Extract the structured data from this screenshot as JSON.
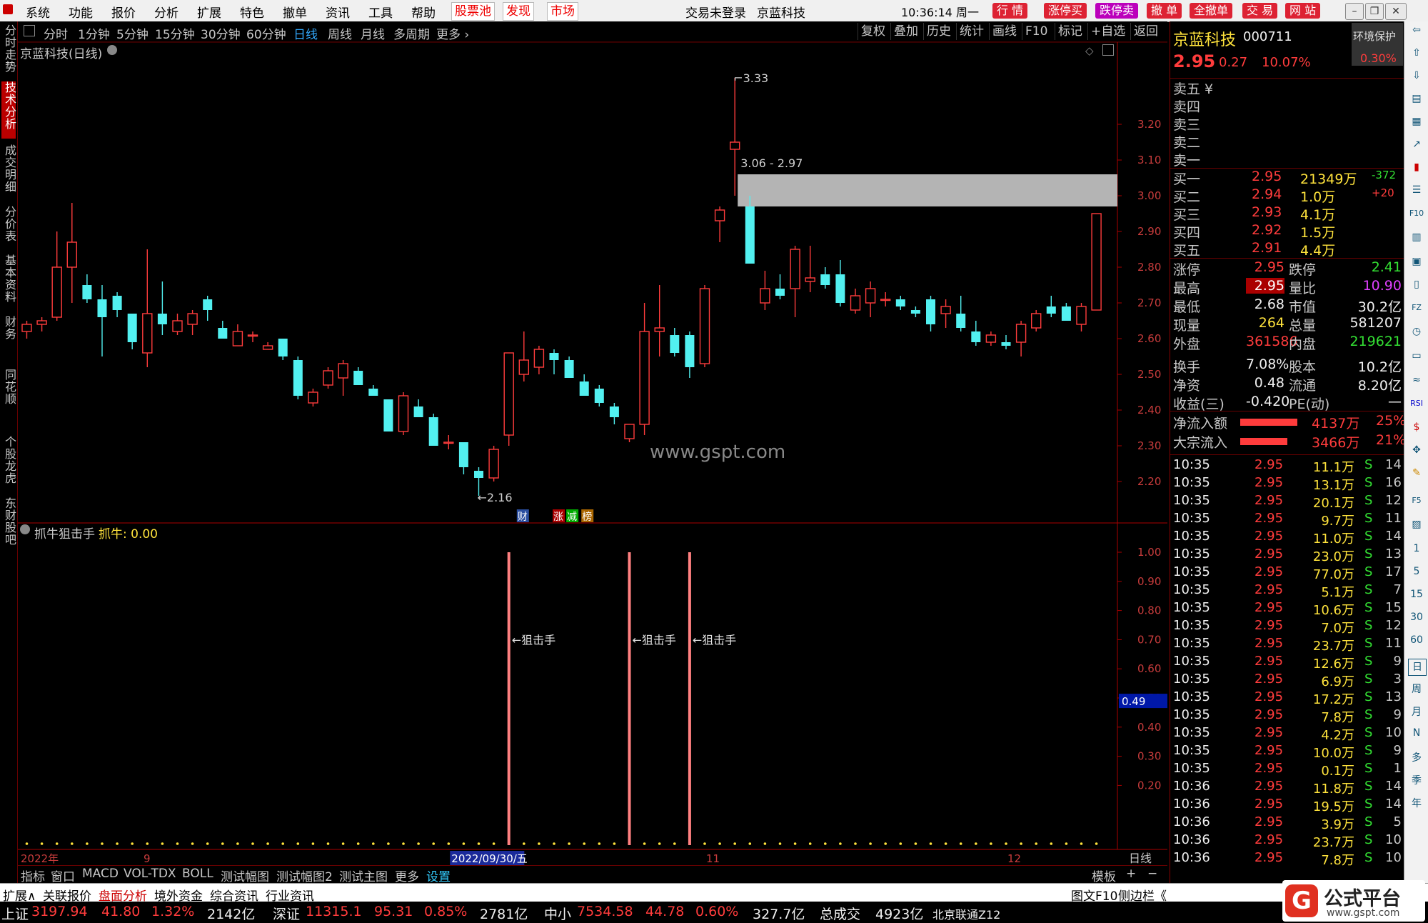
{
  "menu": {
    "items": [
      "系统",
      "功能",
      "报价",
      "分析",
      "扩展",
      "特色",
      "撤单",
      "资讯",
      "工具",
      "帮助"
    ],
    "red_tabs": [
      "股票池",
      "发现",
      "市场"
    ],
    "login_status": "交易未登录",
    "stock_name": "京蓝科技",
    "clock": "10:36:14 周一",
    "buttons": [
      "行 情",
      "涨停买",
      "跌停卖",
      "撤 单",
      "全撤单",
      "交 易",
      "网 站"
    ]
  },
  "left_tabs": [
    {
      "label": "分时走势",
      "active": false
    },
    {
      "label": "技术分析",
      "active": true
    },
    {
      "label": "成交明细",
      "active": false
    },
    {
      "label": "分价表",
      "active": false
    },
    {
      "label": "基本资料",
      "active": false
    },
    {
      "label": "财务",
      "active": false
    },
    {
      "label": "同花顺",
      "active": false
    },
    {
      "label": "个股龙虎",
      "active": false
    },
    {
      "label": "东财股吧",
      "active": false
    }
  ],
  "chart_toolbar": {
    "periods": [
      "分时",
      "1分钟",
      "5分钟",
      "15分钟",
      "30分钟",
      "60分钟",
      "日线",
      "周线",
      "月线",
      "多周期",
      "更多 ›"
    ],
    "selected": "日线",
    "right_tools": [
      "复权",
      "叠加",
      "历史",
      "统计",
      "画线",
      "F10",
      "标记",
      "+自选",
      "返回"
    ]
  },
  "main_chart": {
    "title": "京蓝科技(日线)",
    "high_label": "3.33",
    "low_label": "2.16",
    "gap_label": "3.06 - 2.97",
    "watermark": "www.gspt.com",
    "markers": [
      "财",
      "涨",
      "减",
      "榜"
    ]
  },
  "indicator": {
    "title": "抓牛狙击手",
    "value_label": "抓牛: 0.00",
    "signal_label": "←狙击手",
    "current_value": "0.49"
  },
  "x_axis": {
    "labels": [
      "2022年",
      "9",
      "2022/09/30/五",
      "11",
      "12"
    ],
    "right": "日线"
  },
  "bottom_tabs": [
    "指标",
    "窗口",
    "MACD",
    "VOL-TDX",
    "BOLL",
    "测试幅图",
    "测试幅图2",
    "测试主图",
    "更多",
    "设置"
  ],
  "bottom_right": [
    "模板",
    "+",
    "−"
  ],
  "quote": {
    "name": "京蓝科技",
    "code": "000711",
    "env_label": "环境保护",
    "env_pct": "0.30%",
    "price": "2.95",
    "change": "0.27",
    "change_pct": "10.07%",
    "sells": [
      "卖五 ¥",
      "卖四",
      "卖三",
      "卖二",
      "卖一"
    ],
    "buys": [
      {
        "label": "买一",
        "price": "2.95",
        "vol": "21349万",
        "delta": "-372"
      },
      {
        "label": "买二",
        "price": "2.94",
        "vol": "1.0万",
        "delta": "+20"
      },
      {
        "label": "买三",
        "price": "2.93",
        "vol": "4.1万",
        "delta": ""
      },
      {
        "label": "买四",
        "price": "2.92",
        "vol": "1.5万",
        "delta": ""
      },
      {
        "label": "买五",
        "price": "2.91",
        "vol": "4.4万",
        "delta": ""
      }
    ],
    "stats": [
      {
        "l1": "涨停",
        "v1": "2.95",
        "l2": "跌停",
        "v2": "2.41"
      },
      {
        "l1": "最高",
        "v1": "2.95",
        "l2": "量比",
        "v2": "10.90"
      },
      {
        "l1": "最低",
        "v1": "2.68",
        "l2": "市值",
        "v2": "30.2亿"
      },
      {
        "l1": "现量",
        "v1": "264",
        "l2": "总量",
        "v2": "581207"
      },
      {
        "l1": "外盘",
        "v1": "361586",
        "l2": "内盘",
        "v2": "219621"
      },
      {
        "l1": "换手",
        "v1": "7.08%",
        "l2": "股本",
        "v2": "10.2亿"
      },
      {
        "l1": "净资",
        "v1": "0.48",
        "l2": "流通",
        "v2": "8.20亿"
      },
      {
        "l1": "收益(三)",
        "v1": "-0.420",
        "l2": "PE(动)",
        "v2": "—"
      }
    ],
    "flows": [
      {
        "label": "净流入额",
        "amount": "4137万",
        "pct": "25%"
      },
      {
        "label": "大宗流入",
        "amount": "3466万",
        "pct": "21%"
      }
    ],
    "ticks": [
      {
        "t": "10:35",
        "p": "2.95",
        "v": "11.1万",
        "s": "S",
        "n": "14"
      },
      {
        "t": "10:35",
        "p": "2.95",
        "v": "13.1万",
        "s": "S",
        "n": "16"
      },
      {
        "t": "10:35",
        "p": "2.95",
        "v": "20.1万",
        "s": "S",
        "n": "12"
      },
      {
        "t": "10:35",
        "p": "2.95",
        "v": "9.7万",
        "s": "S",
        "n": "11"
      },
      {
        "t": "10:35",
        "p": "2.95",
        "v": "11.0万",
        "s": "S",
        "n": "14"
      },
      {
        "t": "10:35",
        "p": "2.95",
        "v": "23.0万",
        "s": "S",
        "n": "13"
      },
      {
        "t": "10:35",
        "p": "2.95",
        "v": "77.0万",
        "s": "S",
        "n": "17"
      },
      {
        "t": "10:35",
        "p": "2.95",
        "v": "5.1万",
        "s": "S",
        "n": "7"
      },
      {
        "t": "10:35",
        "p": "2.95",
        "v": "10.6万",
        "s": "S",
        "n": "15"
      },
      {
        "t": "10:35",
        "p": "2.95",
        "v": "7.0万",
        "s": "S",
        "n": "12"
      },
      {
        "t": "10:35",
        "p": "2.95",
        "v": "23.7万",
        "s": "S",
        "n": "11"
      },
      {
        "t": "10:35",
        "p": "2.95",
        "v": "12.6万",
        "s": "S",
        "n": "9"
      },
      {
        "t": "10:35",
        "p": "2.95",
        "v": "6.9万",
        "s": "S",
        "n": "3"
      },
      {
        "t": "10:35",
        "p": "2.95",
        "v": "17.2万",
        "s": "S",
        "n": "13"
      },
      {
        "t": "10:35",
        "p": "2.95",
        "v": "7.8万",
        "s": "S",
        "n": "9"
      },
      {
        "t": "10:35",
        "p": "2.95",
        "v": "4.2万",
        "s": "S",
        "n": "10"
      },
      {
        "t": "10:35",
        "p": "2.95",
        "v": "10.0万",
        "s": "S",
        "n": "9"
      },
      {
        "t": "10:35",
        "p": "2.95",
        "v": "0.1万",
        "s": "S",
        "n": "1"
      },
      {
        "t": "10:36",
        "p": "2.95",
        "v": "11.8万",
        "s": "S",
        "n": "14"
      },
      {
        "t": "10:36",
        "p": "2.95",
        "v": "19.5万",
        "s": "S",
        "n": "14"
      },
      {
        "t": "10:36",
        "p": "2.95",
        "v": "3.9万",
        "s": "S",
        "n": "5"
      },
      {
        "t": "10:36",
        "p": "2.95",
        "v": "23.7万",
        "s": "S",
        "n": "10"
      },
      {
        "t": "10:36",
        "p": "2.95",
        "v": "7.8万",
        "s": "S",
        "n": "10"
      }
    ],
    "bottom_tabs": [
      "笔",
      "价",
      "细",
      "势"
    ]
  },
  "icon_bar": [
    "1",
    "5",
    "15",
    "30",
    "60",
    "日",
    "周",
    "月",
    "N",
    "多",
    "季",
    "年"
  ],
  "func_bar": {
    "left": [
      "扩展∧",
      "关联报价",
      "盘面分析",
      "境外资金",
      "综合资讯",
      "行业资讯"
    ],
    "right": [
      "图文F10",
      "侧边栏《"
    ]
  },
  "status": {
    "sh_label": "上证",
    "sh_index": "3197.94",
    "sh_chg": "41.80",
    "sh_pct": "1.32%",
    "sh_amt": "2142亿",
    "sz_label": "深证",
    "sz_index": "11315.1",
    "sz_chg": "95.31",
    "sz_pct": "0.85%",
    "sz_amt": "2781亿",
    "zx_label": "中小",
    "zx_index": "7534.58",
    "zx_chg": "44.78",
    "zx_pct": "0.60%",
    "zx_amt": "327.7亿",
    "total_label": "总成交",
    "total_amt": "4923亿",
    "extra": "北京联通Z12",
    "logo_text": "公式平台",
    "logo_url": "www.gspt.com"
  },
  "chart_data": [
    {
      "type": "candlestick",
      "title": "京蓝科技(日线)",
      "y_ticks": [
        2.2,
        2.3,
        2.4,
        2.5,
        2.6,
        2.7,
        2.8,
        2.9,
        3.0,
        3.1,
        3.2
      ],
      "ylim": [
        2.13,
        3.37
      ],
      "candles": [
        [
          2.62,
          2.65,
          2.6,
          2.64
        ],
        [
          2.64,
          2.66,
          2.62,
          2.65
        ],
        [
          2.66,
          2.9,
          2.65,
          2.8
        ],
        [
          2.8,
          2.98,
          2.7,
          2.87
        ],
        [
          2.75,
          2.78,
          2.7,
          2.71
        ],
        [
          2.71,
          2.75,
          2.55,
          2.66
        ],
        [
          2.72,
          2.73,
          2.66,
          2.68
        ],
        [
          2.67,
          2.67,
          2.57,
          2.59
        ],
        [
          2.56,
          2.85,
          2.52,
          2.67
        ],
        [
          2.67,
          2.76,
          2.61,
          2.64
        ],
        [
          2.62,
          2.67,
          2.61,
          2.65
        ],
        [
          2.64,
          2.68,
          2.61,
          2.67
        ],
        [
          2.71,
          2.72,
          2.65,
          2.68
        ],
        [
          2.63,
          2.65,
          2.6,
          2.6
        ],
        [
          2.58,
          2.64,
          2.58,
          2.62
        ],
        [
          2.61,
          2.62,
          2.59,
          2.61
        ],
        [
          2.57,
          2.59,
          2.57,
          2.58
        ],
        [
          2.6,
          2.6,
          2.54,
          2.55
        ],
        [
          2.54,
          2.55,
          2.43,
          2.44
        ],
        [
          2.42,
          2.46,
          2.41,
          2.45
        ],
        [
          2.47,
          2.52,
          2.46,
          2.51
        ],
        [
          2.49,
          2.54,
          2.44,
          2.53
        ],
        [
          2.51,
          2.52,
          2.47,
          2.47
        ],
        [
          2.46,
          2.47,
          2.44,
          2.44
        ],
        [
          2.43,
          2.43,
          2.34,
          2.34
        ],
        [
          2.34,
          2.45,
          2.33,
          2.44
        ],
        [
          2.41,
          2.43,
          2.38,
          2.38
        ],
        [
          2.38,
          2.39,
          2.3,
          2.3
        ],
        [
          2.31,
          2.33,
          2.29,
          2.31
        ],
        [
          2.31,
          2.31,
          2.22,
          2.24
        ],
        [
          2.23,
          2.24,
          2.16,
          2.21
        ],
        [
          2.21,
          2.3,
          2.2,
          2.29
        ],
        [
          2.33,
          2.56,
          2.3,
          2.56
        ],
        [
          2.5,
          2.62,
          2.48,
          2.54
        ],
        [
          2.52,
          2.58,
          2.5,
          2.57
        ],
        [
          2.56,
          2.57,
          2.5,
          2.54
        ],
        [
          2.54,
          2.55,
          2.49,
          2.49
        ],
        [
          2.48,
          2.5,
          2.44,
          2.44
        ],
        [
          2.46,
          2.47,
          2.41,
          2.42
        ],
        [
          2.41,
          2.42,
          2.36,
          2.38
        ],
        [
          2.32,
          2.36,
          2.31,
          2.36
        ],
        [
          2.36,
          2.7,
          2.33,
          2.62
        ],
        [
          2.62,
          2.75,
          2.55,
          2.63
        ],
        [
          2.61,
          2.63,
          2.55,
          2.56
        ],
        [
          2.61,
          2.62,
          2.49,
          2.52
        ],
        [
          2.53,
          2.75,
          2.52,
          2.74
        ],
        [
          2.93,
          2.97,
          2.87,
          2.96
        ],
        [
          3.13,
          3.33,
          3.0,
          3.15
        ],
        [
          2.97,
          3.0,
          2.81,
          2.81
        ],
        [
          2.7,
          2.79,
          2.68,
          2.74
        ],
        [
          2.74,
          2.78,
          2.71,
          2.72
        ],
        [
          2.74,
          2.86,
          2.66,
          2.85
        ],
        [
          2.76,
          2.86,
          2.73,
          2.77
        ],
        [
          2.78,
          2.8,
          2.74,
          2.75
        ],
        [
          2.78,
          2.82,
          2.69,
          2.7
        ],
        [
          2.68,
          2.74,
          2.67,
          2.72
        ],
        [
          2.7,
          2.76,
          2.66,
          2.74
        ],
        [
          2.71,
          2.73,
          2.69,
          2.71
        ],
        [
          2.71,
          2.72,
          2.68,
          2.69
        ],
        [
          2.68,
          2.69,
          2.66,
          2.67
        ],
        [
          2.71,
          2.72,
          2.62,
          2.64
        ],
        [
          2.67,
          2.71,
          2.63,
          2.69
        ],
        [
          2.67,
          2.72,
          2.62,
          2.63
        ],
        [
          2.62,
          2.65,
          2.58,
          2.59
        ],
        [
          2.59,
          2.62,
          2.58,
          2.61
        ],
        [
          2.59,
          2.61,
          2.57,
          2.58
        ],
        [
          2.59,
          2.65,
          2.55,
          2.64
        ],
        [
          2.63,
          2.68,
          2.62,
          2.67
        ],
        [
          2.69,
          2.72,
          2.66,
          2.67
        ],
        [
          2.69,
          2.7,
          2.65,
          2.65
        ],
        [
          2.64,
          2.7,
          2.62,
          2.69
        ],
        [
          2.68,
          2.95,
          2.68,
          2.95
        ]
      ],
      "high": 3.33,
      "low": 2.16,
      "gap": [
        2.97,
        3.06
      ]
    },
    {
      "type": "bar",
      "title": "抓牛狙击手",
      "y_ticks": [
        0.2,
        0.3,
        0.4,
        0.5,
        0.6,
        0.7,
        0.8,
        0.9,
        1.0
      ],
      "ylim": [
        0.0,
        1.0
      ],
      "signals_at_candle": [
        32,
        40,
        44
      ],
      "signal_value": 1.0,
      "current_value": 0.49
    }
  ]
}
